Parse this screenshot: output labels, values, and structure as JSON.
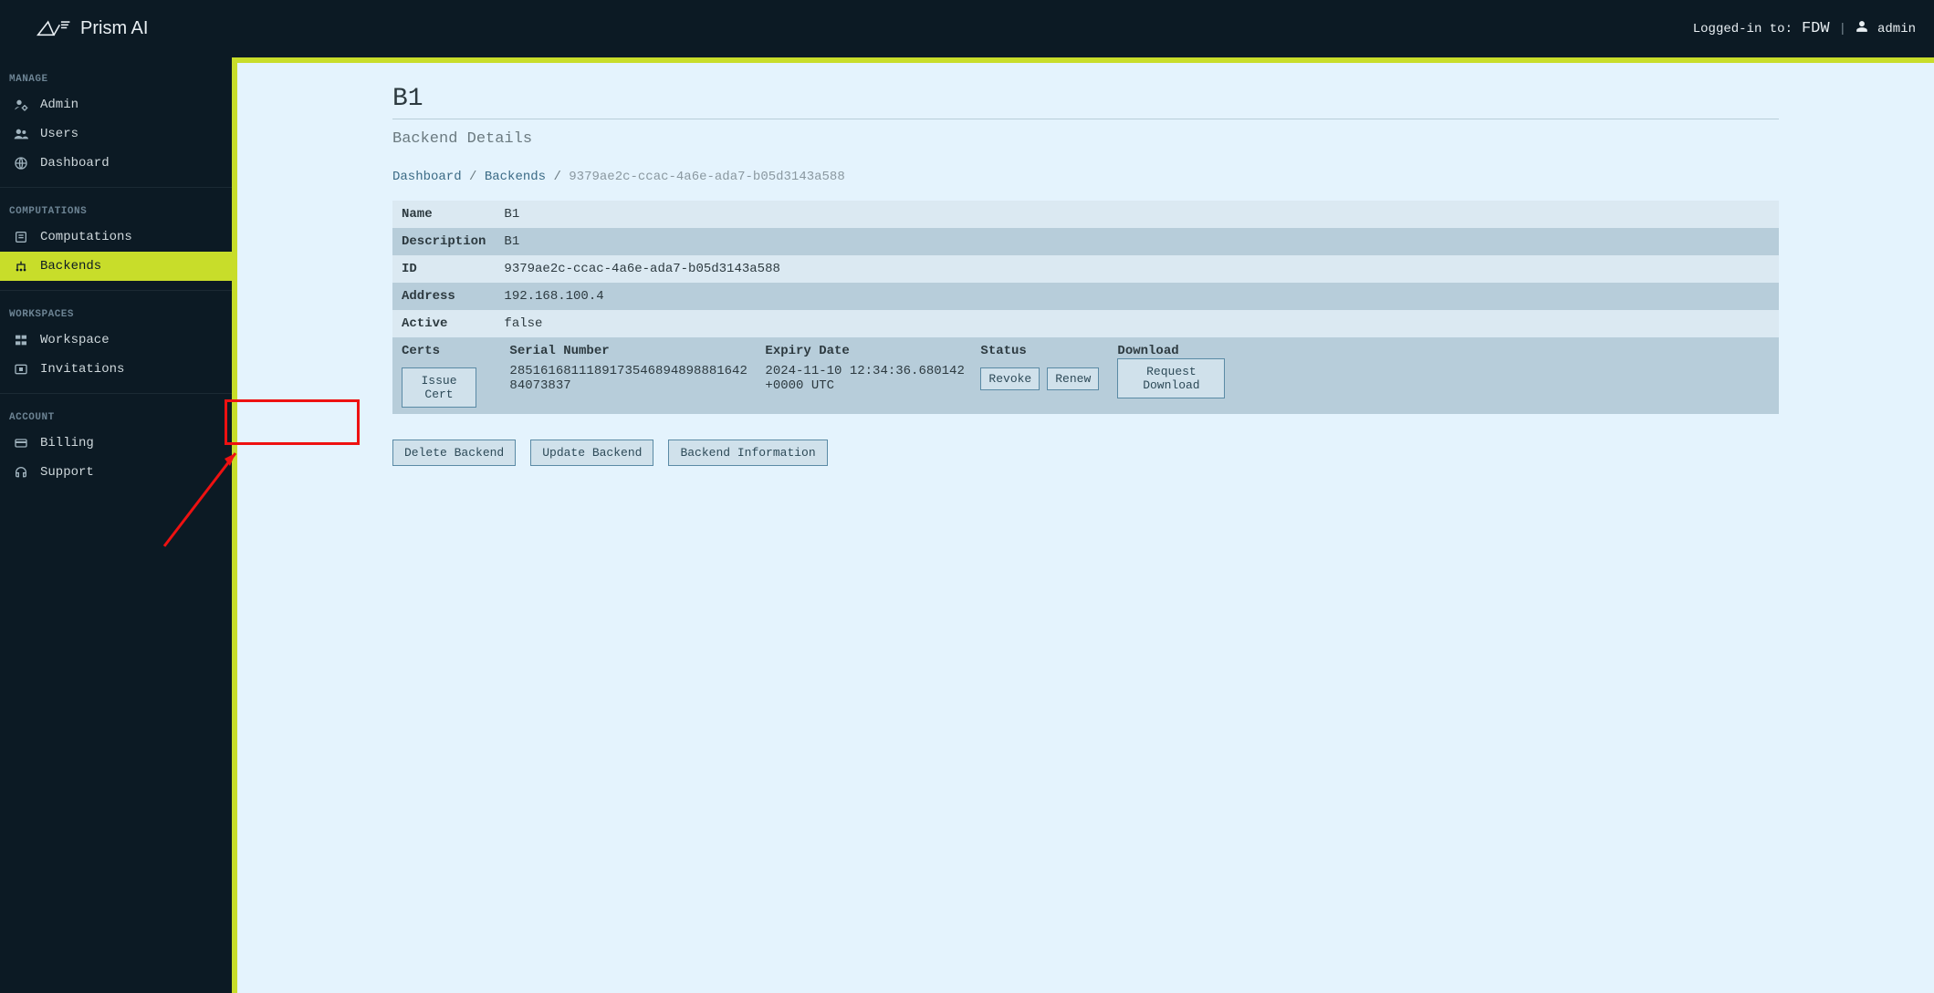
{
  "header": {
    "brand": "Prism AI",
    "logged_in_label": "Logged-in to:",
    "workspace": "FDW",
    "user": "admin"
  },
  "sidebar": {
    "sections": {
      "manage": "MANAGE",
      "computations": "COMPUTATIONS",
      "workspaces": "WORKSPACES",
      "account": "ACCOUNT"
    },
    "items": {
      "admin": "Admin",
      "users": "Users",
      "dashboard": "Dashboard",
      "computations": "Computations",
      "backends": "Backends",
      "workspace": "Workspace",
      "invitations": "Invitations",
      "billing": "Billing",
      "support": "Support"
    }
  },
  "page": {
    "title": "B1",
    "subtitle": "Backend Details",
    "breadcrumb": {
      "dashboard": "Dashboard",
      "backends": "Backends",
      "id": "9379ae2c-ccac-4a6e-ada7-b05d3143a588"
    }
  },
  "details": {
    "labels": {
      "name": "Name",
      "description": "Description",
      "id": "ID",
      "address": "Address",
      "active": "Active",
      "certs": "Certs"
    },
    "values": {
      "name": "B1",
      "description": "B1",
      "id": "9379ae2c-ccac-4a6e-ada7-b05d3143a588",
      "address": "192.168.100.4",
      "active": "false"
    }
  },
  "certs": {
    "headers": {
      "serial": "Serial Number",
      "expiry": "Expiry Date",
      "status": "Status",
      "download": "Download"
    },
    "issue_btn": "Issue Cert",
    "rows": [
      {
        "serial": "285161681118917354689489888164284073837",
        "expiry": "2024-11-10 12:34:36.680142 +0000 UTC",
        "revoke_btn": "Revoke",
        "renew_btn": "Renew",
        "download_btn": "Request Download"
      }
    ]
  },
  "actions": {
    "delete": "Delete Backend",
    "update": "Update Backend",
    "info": "Backend Information"
  }
}
